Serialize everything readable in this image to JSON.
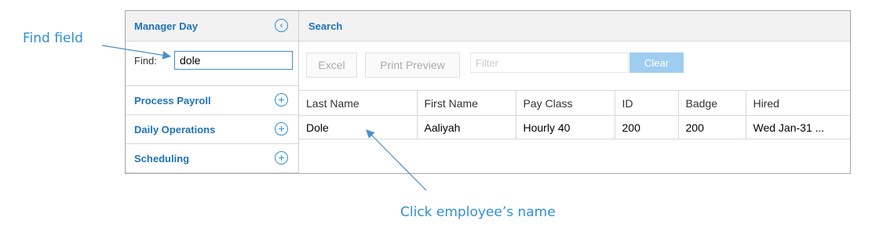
{
  "annotations": {
    "find_field": "Find field",
    "click_name": "Click employee’s name"
  },
  "sidebar": {
    "title": "Manager Day",
    "find_label": "Find:",
    "find_value": "dole",
    "items": [
      {
        "label": "Process Payroll"
      },
      {
        "label": "Daily Operations"
      },
      {
        "label": "Scheduling"
      }
    ]
  },
  "main": {
    "title": "Search",
    "toolbar": {
      "excel_label": "Excel",
      "print_label": "Print Preview",
      "filter_placeholder": "Filter",
      "clear_label": "Clear"
    },
    "table": {
      "columns": [
        "Last Name",
        "First Name",
        "Pay Class",
        "ID",
        "Badge",
        "Hired"
      ],
      "rows": [
        {
          "last_name": "Dole",
          "first_name": "Aaliyah",
          "pay_class": "Hourly 40",
          "id": "200",
          "badge": "200",
          "hired": "Wed Jan-31 ..."
        }
      ]
    }
  },
  "colors": {
    "accent": "#1f73b7",
    "annotation": "#2e8fd2",
    "clear_button": "#9fcdf0"
  },
  "icons": {
    "collapse": "chevron-left-circle-icon",
    "expand": "plus-circle-icon"
  }
}
